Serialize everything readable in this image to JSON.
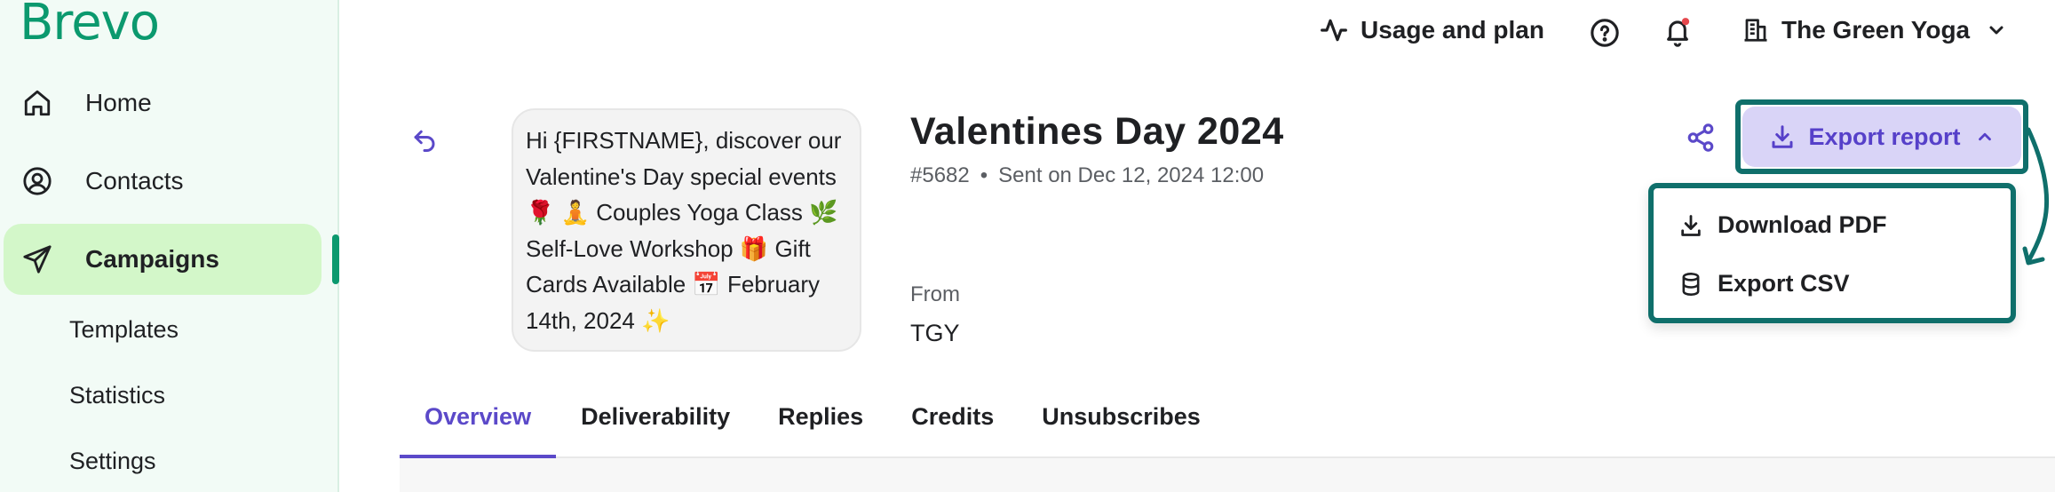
{
  "brand": {
    "logo_text": "Brevo",
    "accent": "#0b996e"
  },
  "sidebar": {
    "items": [
      {
        "label": "Home",
        "icon": "home-icon"
      },
      {
        "label": "Contacts",
        "icon": "contacts-icon"
      },
      {
        "label": "Campaigns",
        "icon": "send-icon",
        "active": true
      }
    ],
    "sub_items": [
      {
        "label": "Templates"
      },
      {
        "label": "Statistics"
      },
      {
        "label": "Settings"
      }
    ]
  },
  "topbar": {
    "usage_label": "Usage and plan",
    "account_name": "The Green Yoga"
  },
  "campaign": {
    "preview_text": "Hi {FIRSTNAME}, discover our Valentine's Day special events 🌹 🧘 Couples Yoga Class 🌿 Self-Love Workshop 🎁 Gift Cards Available 📅 February 14th, 2024 ✨",
    "title": "Valentines Day 2024",
    "id": "#5682",
    "sent": "Sent on Dec 12, 2024 12:00",
    "from_label": "From",
    "from_value": "TGY"
  },
  "actions": {
    "export_label": "Export report",
    "menu": [
      {
        "label": "Download PDF",
        "icon": "download-icon"
      },
      {
        "label": "Export CSV",
        "icon": "database-icon"
      }
    ]
  },
  "tabs": [
    {
      "label": "Overview",
      "active": true
    },
    {
      "label": "Deliverability"
    },
    {
      "label": "Replies"
    },
    {
      "label": "Credits"
    },
    {
      "label": "Unsubscribes"
    }
  ],
  "colors": {
    "primary": "#5b49c9",
    "highlight_frame": "#0f6f6b",
    "active_nav_bg": "#d3f7c9"
  }
}
